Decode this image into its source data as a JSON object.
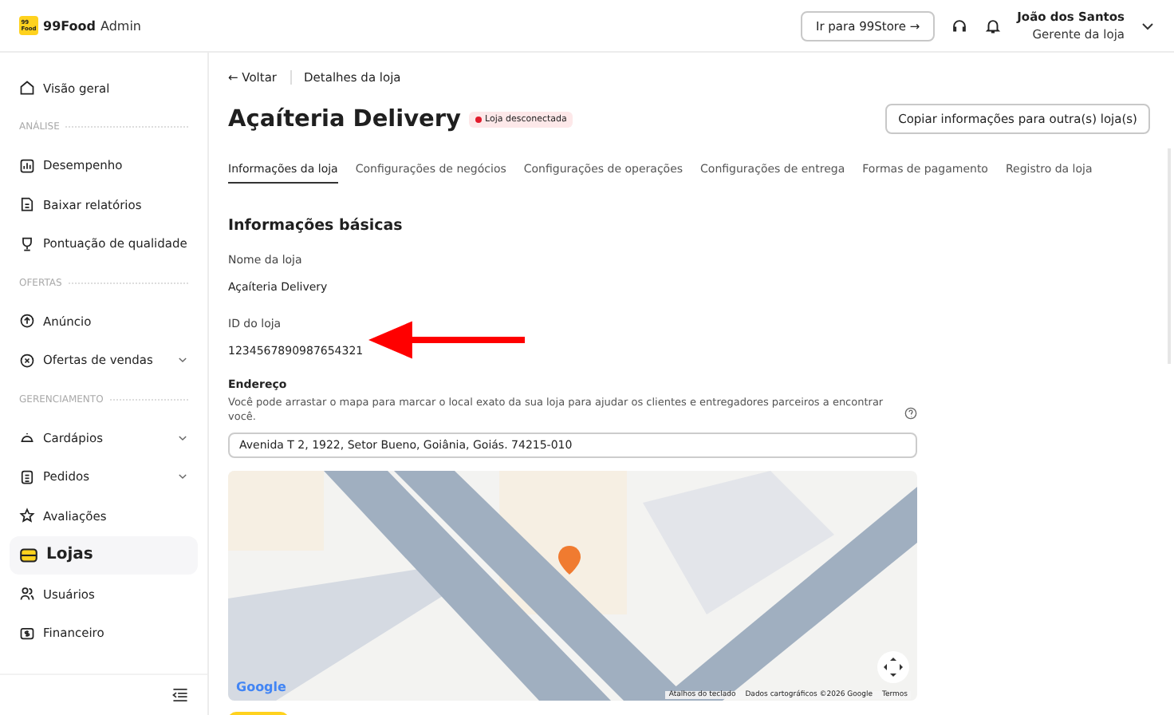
{
  "header": {
    "logo_badge": "99\nFood",
    "brand": "99Food",
    "brand_suffix": "Admin",
    "store_button": "Ir para 99Store →",
    "user": {
      "name": "João dos Santos",
      "role": "Gerente da loja"
    }
  },
  "sidebar": {
    "items": [
      {
        "kind": "item",
        "label": "Visão geral",
        "selected": false
      },
      {
        "kind": "section",
        "label": "ANÁLISE"
      },
      {
        "kind": "item",
        "label": "Desempenho",
        "selected": false
      },
      {
        "kind": "item",
        "label": "Baixar relatórios",
        "selected": false
      },
      {
        "kind": "item",
        "label": "Pontuação de qualidade",
        "selected": false
      },
      {
        "kind": "section",
        "label": "OFERTAS"
      },
      {
        "kind": "item",
        "label": "Anúncio",
        "selected": false
      },
      {
        "kind": "item",
        "label": "Ofertas de vendas",
        "selected": false,
        "expanded": false
      },
      {
        "kind": "section",
        "label": "GERENCIAMENTO"
      },
      {
        "kind": "item",
        "label": "Cardápios",
        "selected": false,
        "expanded": false
      },
      {
        "kind": "item",
        "label": "Pedidos",
        "selected": false,
        "expanded": false
      },
      {
        "kind": "item",
        "label": "Avaliações",
        "selected": false
      },
      {
        "kind": "item",
        "label": "Lojas",
        "selected": true
      },
      {
        "kind": "item",
        "label": "Usuários",
        "selected": false
      },
      {
        "kind": "item",
        "label": "Financeiro",
        "selected": false
      }
    ]
  },
  "breadcrumb": {
    "back": "← Voltar",
    "current": "Detalhes da loja"
  },
  "title": "Açaíteria Delivery",
  "status_badge": "Loja desconectada",
  "copy_button": "Copiar informações para outra(s) loja(s)",
  "tabs": [
    {
      "label": "Informações da loja",
      "selected": true
    },
    {
      "label": "Configurações de negócios",
      "selected": false
    },
    {
      "label": "Configurações de operações",
      "selected": false
    },
    {
      "label": "Configurações de entrega",
      "selected": false
    },
    {
      "label": "Formas de pagamento",
      "selected": false
    },
    {
      "label": "Registro da loja",
      "selected": false
    }
  ],
  "section_title": "Informações básicas",
  "fields": [
    {
      "label": "Nome da loja",
      "value": "Açaíteria Delivery"
    },
    {
      "label": "ID do loja",
      "value": "1234567890987654321"
    }
  ],
  "address": {
    "label": "Endereço",
    "help": "Você pode arrastar o mapa para marcar o local exato da sua loja para ajudar os clientes e entregadores parceiros a encontrar você.",
    "value": "Avenida T 2, 1922, Setor Bueno, Goiânia, Goiás. 74215-010"
  },
  "map": {
    "logo": "Google",
    "attribution": [
      "Atalhos do teclado",
      "Dados cartográficos ©2026 Google",
      "Termos"
    ]
  }
}
